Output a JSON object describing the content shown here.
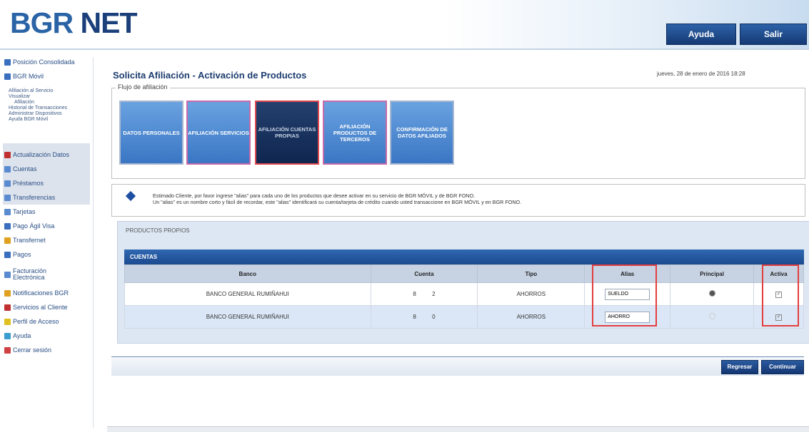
{
  "header": {
    "logo_a": "BGR ",
    "logo_b": "NET",
    "help_label": "Ayuda",
    "exit_label": "Salir"
  },
  "sidebar": {
    "items": [
      {
        "label": "Posición Consolidada",
        "icon": "chart-icon",
        "color": "#3a6fbf"
      },
      {
        "label": "BGR Móvil",
        "icon": "phone-icon",
        "color": "#3a6fbf"
      },
      {
        "label": "Actualización Datos",
        "icon": "user-icon",
        "color": "#c03030"
      },
      {
        "label": "Cuentas",
        "icon": "folder-icon",
        "color": "#5a8ad0"
      },
      {
        "label": "Préstamos",
        "icon": "document-icon",
        "color": "#5a8ad0"
      },
      {
        "label": "Transferencias",
        "icon": "transfer-icon",
        "color": "#5a8ad0"
      },
      {
        "label": "Tarjetas",
        "icon": "card-icon",
        "color": "#5a8ad0"
      },
      {
        "label": "Pago Ágil Visa",
        "icon": "visa-icon",
        "color": "#3a6fbf"
      },
      {
        "label": "Transfernet",
        "icon": "star-icon",
        "color": "#e0a020"
      },
      {
        "label": "Pagos",
        "icon": "pay-icon",
        "color": "#3a6fbf"
      },
      {
        "label": "Facturación Electrónica",
        "icon": "invoice-icon",
        "color": "#5a8ad0"
      },
      {
        "label": "Notificaciones BGR",
        "icon": "bell-icon",
        "color": "#e0a020"
      },
      {
        "label": "Servicios al Cliente",
        "icon": "service-icon",
        "color": "#c03030"
      },
      {
        "label": "Perfil de Acceso",
        "icon": "profile-icon",
        "color": "#e0c020"
      },
      {
        "label": "Ayuda",
        "icon": "help-icon",
        "color": "#3a9fd0"
      },
      {
        "label": "Cerrar sesión",
        "icon": "logout-icon",
        "color": "#d04040"
      }
    ],
    "subitems": [
      "Afiliación al Servicio",
      "Visualizar",
      "Afiliación",
      "Historial de Transacciones",
      "Administrar Dispositivos",
      "Ayuda BGR Móvil"
    ]
  },
  "main": {
    "title": "Solicita Afiliación - Activación de Productos",
    "date": "jueves, 28 de enero de 2016 18:28",
    "flow_legend": "Flujo de afiliación",
    "steps": [
      "DATOS PERSONALES",
      "AFILIACIÓN SERVICIOS",
      "AFILIACIÓN CUENTAS PROPIAS",
      "AFILIACIÓN PRODUCTOS DE TERCEROS",
      "CONFIRMACIÓN DE DATOS AFILIADOS"
    ],
    "notice_line1": "Estimado Cliente, por favor ingrese \"alias\" para cada uno de los productos que desee activar en su servicio de BGR MÓVIL y de BGR FONO.",
    "notice_line2": "Un \"alias\" es un nombre corto y fácil de recordar, este \"alias\" identificará su cuenta/tarjeta de crédito cuando usted transaccione en BGR MÓVIL y en BGR FONO.",
    "products_legend": "PRODUCTOS PROPIOS",
    "section_title": "CUENTAS",
    "columns": [
      "Banco",
      "Cuenta",
      "Tipo",
      "Alias",
      "Principal",
      "Activa"
    ],
    "rows": [
      {
        "banco": "BANCO GENERAL RUMIÑAHUI",
        "cuenta_a": "8",
        "cuenta_b": "2",
        "tipo": "AHORROS",
        "alias": "SUELDO"
      },
      {
        "banco": "BANCO GENERAL RUMIÑAHUI",
        "cuenta_a": "8",
        "cuenta_b": "0",
        "tipo": "AHORROS",
        "alias": "AHORRO"
      }
    ],
    "back_label": "Regresar",
    "continue_label": "Continuar"
  }
}
